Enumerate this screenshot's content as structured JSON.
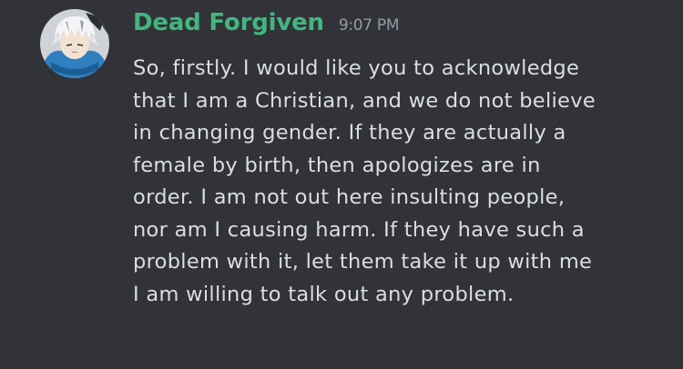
{
  "message": {
    "author": "Dead Forgiven",
    "timestamp": "9:07 PM",
    "lines": [
      "So, firstly. I would like you to acknowledge",
      "that I am a Christian, and we do not believe",
      "in changing gender. If they are actually a",
      "female by birth, then apologizes are in",
      "order. I am not out here insulting people,",
      "nor am I causing harm. If they have such a",
      "problem with it, let them take it up with me",
      "I am willing to talk out any problem."
    ]
  },
  "colors": {
    "background": "#313338",
    "username": "#43b581",
    "timestamp": "#949ba4",
    "text": "#dbdee1"
  },
  "icons": {
    "avatar": "user-avatar-anime-character"
  }
}
